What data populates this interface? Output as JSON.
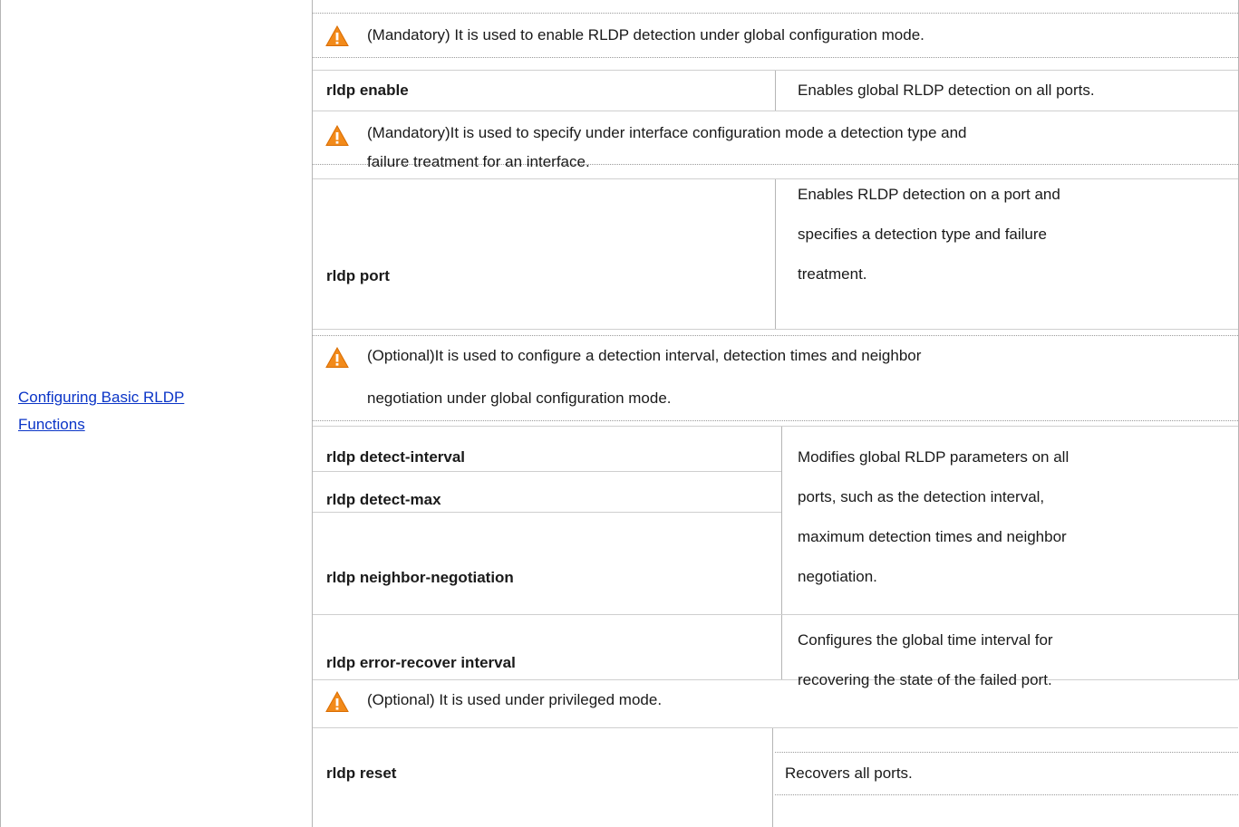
{
  "left_link": {
    "line1": "Configuring Basic RLDP ",
    "line2": "Functions"
  },
  "notes": [
    {
      "line1": "(Mandatory) It is used to enable RLDP detection under global configuration mode."
    },
    {
      "line1": "(Mandatory)It is used to specify under interface configuration mode a detection type and",
      "line2": "failure treatment for an interface."
    },
    {
      "line1": "(Optional)It is used to configure a detection interval, detection times and neighbor",
      "line2": "negotiation under global configuration mode."
    },
    {
      "line1": "(Optional) It is used under privileged mode."
    }
  ],
  "commands": {
    "enable": "rldp enable",
    "port": "rldp port",
    "detect_interval": "rldp detect-interval",
    "detect_max": "rldp detect-max",
    "neighbor_negotiation": "rldp neighbor-negotiation",
    "error_recover": "rldp error-recover interval",
    "reset": "rldp reset"
  },
  "descriptions": {
    "enable": "Enables global RLDP detection on all ports.",
    "port": [
      "Enables RLDP detection on a port and",
      "specifies a detection type and failure",
      "treatment."
    ],
    "params": [
      "Modifies global RLDP parameters on all",
      "ports, such as the detection interval,",
      "maximum detection times and neighbor",
      "negotiation."
    ],
    "error_recover": [
      "Configures the global time interval for",
      "recovering the state of the failed port."
    ],
    "reset": "Recovers all ports."
  },
  "icons": {
    "warning": "warning-triangle-icon"
  },
  "colors": {
    "link": "#0b35c7",
    "warning_fill": "#f28a1a",
    "warning_mark": "#ffffff"
  }
}
